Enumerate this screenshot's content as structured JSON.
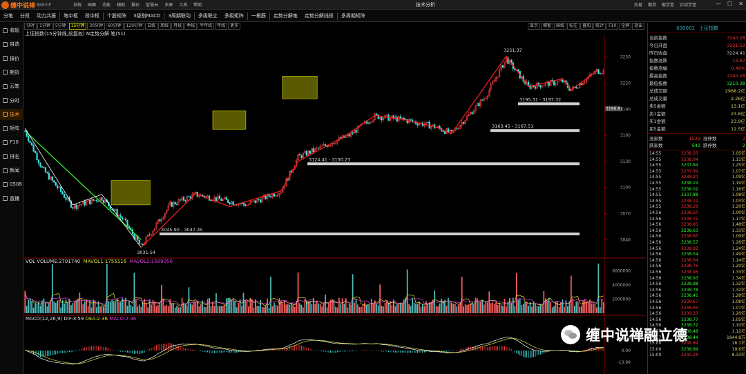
{
  "app": {
    "logo": "缠中说禅",
    "logo_sub": "888VIP",
    "window_title": "技术分析"
  },
  "top_menu": [
    "系统",
    "画面",
    "功能",
    "辅助",
    "报价",
    "智慧云",
    "多屏",
    "工具",
    "帮助"
  ],
  "top_right": [
    "交易",
    "期货",
    "融学堂",
    "实战学堂"
  ],
  "toolbar": [
    "分笔",
    "分段",
    "动力共振",
    "笔中枢",
    "段中枢",
    "个股矩阵",
    "3级别MACD",
    "3周期联动",
    "多级联立",
    "多级矩阵",
    "一根筋",
    "走势分解笔",
    "走势分解线段",
    "多周期矩阵"
  ],
  "sidebar": [
    {
      "label": "收起",
      "icon": "collapse-icon"
    },
    {
      "label": "自选",
      "icon": "star-icon"
    },
    {
      "label": "报价",
      "icon": "quote-icon"
    },
    {
      "label": "期货",
      "icon": "futures-icon"
    },
    {
      "label": "云笔",
      "icon": "cloud-icon"
    },
    {
      "label": "分时",
      "icon": "clock-icon"
    },
    {
      "label": "技术",
      "icon": "candle-icon"
    },
    {
      "label": "矩阵",
      "icon": "grid-icon"
    },
    {
      "label": "F10",
      "icon": "doc-icon"
    },
    {
      "label": "排名",
      "icon": "rank-icon"
    },
    {
      "label": "新闻",
      "icon": "news-icon"
    },
    {
      "label": "0508",
      "icon": "bars-icon"
    },
    {
      "label": "直播",
      "icon": "tv-icon"
    }
  ],
  "sidebar_active": 6,
  "periods": [
    "分时",
    "1分钟",
    "5分钟",
    "15分钟",
    "30分钟",
    "60分钟",
    "120分钟",
    "日线",
    "周线",
    "月线",
    "季线",
    "半年线",
    "年线",
    "更多"
  ],
  "period_selected": 3,
  "right_tools": [
    "显示",
    "模板",
    "画线",
    "标注",
    "叠加",
    "统计",
    "F10",
    "全屏",
    "退出"
  ],
  "chart_title": "上证指数(15分钟线,前复权) N走势分解 笔(51)",
  "vol_label": {
    "vol": "VOL VOLUME:2701740",
    "m1": "MAVOL1:1755116",
    "m2": "MAVOL2:1589050"
  },
  "macd_label": {
    "name": "MACD(12,26,9)",
    "dif": "DIF:3.59",
    "dea": "DEA:2.36",
    "macd": "MACD:2.46"
  },
  "chart_data": {
    "type": "candlestick",
    "title": "上证指数(15分钟线,前复权)",
    "price_axis": {
      "ticks": [
        3040,
        3070,
        3100,
        3130,
        3160,
        3190,
        3220,
        3250
      ],
      "range": [
        3022,
        3268
      ],
      "current_marker": "3190.82"
    },
    "vol_axis": {
      "ticks": [
        "6000000",
        "4000000",
        "2000000"
      ]
    },
    "macd_axis": {
      "ticks": [
        "15.00",
        "0.00",
        "-13.99"
      ]
    },
    "zones": [
      {
        "label": "3045.90 - 3047.35",
        "price": 3046.6
      },
      {
        "label": "3124.41 - 3130.23",
        "price": 3127.3
      },
      {
        "label": "3163.45 - 3167.51",
        "price": 3165.5
      },
      {
        "label": "3195.31 - 3197.32",
        "price": 3196.3
      }
    ],
    "annotations": [
      {
        "text": "3251.37",
        "price": 3251.37
      },
      {
        "text": "3031.54",
        "price": 3031.54
      }
    ],
    "key_points": [
      [
        0,
        3165
      ],
      [
        10,
        3122
      ],
      [
        28,
        3078
      ],
      [
        45,
        3088
      ],
      [
        58,
        3062
      ],
      [
        68,
        3032
      ],
      [
        85,
        3080
      ],
      [
        100,
        3092
      ],
      [
        130,
        3080
      ],
      [
        150,
        3096
      ],
      [
        160,
        3135
      ],
      [
        190,
        3160
      ],
      [
        205,
        3182
      ],
      [
        222,
        3178
      ],
      [
        240,
        3170
      ],
      [
        250,
        3162
      ],
      [
        270,
        3205
      ],
      [
        282,
        3248
      ],
      [
        295,
        3216
      ],
      [
        315,
        3222
      ],
      [
        320,
        3212
      ],
      [
        335,
        3234
      ]
    ]
  },
  "right_panel": {
    "code": "000001",
    "name": "上证指数",
    "rows": [
      {
        "k": "当前指数",
        "v": "3240.28",
        "c": "#ff3030"
      },
      {
        "k": "今日开盘",
        "v": "3221.52",
        "c": "#ff3030"
      },
      {
        "k": "昨日收盘",
        "v": "3224.41",
        "c": "#cccccc"
      },
      {
        "k": "指数涨跌",
        "v": "15.87",
        "c": "#ff3030"
      },
      {
        "k": "指数涨幅",
        "v": "0.49%",
        "c": "#ff3030"
      },
      {
        "k": "最高指数",
        "v": "3240.28",
        "c": "#ff3030"
      },
      {
        "k": "最低指数",
        "v": "3210.38",
        "c": "#30ff30"
      },
      {
        "k": "总成交额",
        "v": "2968.2亿",
        "c": "#e0d070"
      },
      {
        "k": "总成交量",
        "v": "2.26亿",
        "c": "#e0d070"
      },
      {
        "k": "卖5金额",
        "v": "13.1亿",
        "c": "#e0d070"
      },
      {
        "k": "卖1金额",
        "v": "23.8亿",
        "c": "#e0d070"
      },
      {
        "k": "买1金额",
        "v": "23.9亿",
        "c": "#e0d070"
      },
      {
        "k": "买5金额",
        "v": "12.5亿",
        "c": "#e0d070"
      }
    ],
    "adv": {
      "k1": "涨家数",
      "v1": "1529",
      "k2": "涨停数",
      "v2": "2"
    },
    "dec": {
      "k1": "跌家数",
      "v1": "542",
      "k2": "跌停数",
      "v2": "2"
    },
    "ticks": [
      [
        "14:55",
        "3238.25",
        "1.05亿",
        "r"
      ],
      [
        "14:55",
        "3238.04",
        "1.11亿",
        "r"
      ],
      [
        "14:55",
        "3237.84",
        "1.25亿",
        "g"
      ],
      [
        "14:55",
        "3237.99",
        "1.07亿",
        "r"
      ],
      [
        "14:55",
        "3238.20",
        "1.09亿",
        "r"
      ],
      [
        "14:55",
        "3238.19",
        "1.19亿",
        "g"
      ],
      [
        "14:55",
        "3238.02",
        "1.16亿",
        "g"
      ],
      [
        "14:55",
        "3237.88",
        "1.08亿",
        "g"
      ],
      [
        "14:55",
        "3238.12",
        "1.03亿",
        "r"
      ],
      [
        "14:55",
        "3238.29",
        "1.20亿",
        "r"
      ],
      [
        "14:56",
        "3238.50",
        "1.00亿",
        "r"
      ],
      [
        "14:56",
        "3238.71",
        "1.17亿",
        "r"
      ],
      [
        "14:56",
        "3238.83",
        "1.48亿",
        "r"
      ],
      [
        "14:56",
        "3238.63",
        "1.33亿",
        "g"
      ],
      [
        "14:56",
        "3238.65",
        "1.09亿",
        "r"
      ],
      [
        "14:56",
        "3238.57",
        "1.26亿",
        "g"
      ],
      [
        "14:56",
        "3238.82",
        "1.24亿",
        "r"
      ],
      [
        "14:56",
        "3238.54",
        "1.49亿",
        "g"
      ],
      [
        "14:56",
        "3238.64",
        "1.14亿",
        "r"
      ],
      [
        "14:56",
        "3238.76",
        "1.20亿",
        "r"
      ],
      [
        "14:56",
        "3238.96",
        "1.33亿",
        "r"
      ],
      [
        "14:56",
        "3238.93",
        "1.34亿",
        "g"
      ],
      [
        "14:56",
        "3238.88",
        "1.32亿",
        "g"
      ],
      [
        "14:56",
        "3238.78",
        "1.32亿",
        "g"
      ],
      [
        "14:56",
        "3238.41",
        "1.28亿",
        "g"
      ],
      [
        "14:56",
        "3238.67",
        "1.08亿",
        "r"
      ],
      [
        "14:56",
        "3238.69",
        "1.07亿",
        "r"
      ],
      [
        "14:56",
        "3239.23",
        "1.20亿",
        "r"
      ],
      [
        "14:56",
        "3238.77",
        "1.05亿",
        "g"
      ],
      [
        "14:56",
        "3238.72",
        "1.10亿",
        "g"
      ],
      [
        "14:57",
        "3238.48",
        "1.12亿",
        "g"
      ],
      [
        "14:57",
        "3238.44",
        "1844.8万",
        "g"
      ],
      [
        "15:00",
        "3238.89",
        "16.1亿",
        "r"
      ],
      [
        "15:00",
        "3238.89",
        "19.6亿",
        "g"
      ],
      [
        "15:00",
        "3240.28",
        "8.33亿",
        "r"
      ]
    ]
  },
  "watermark": "缠中说禅融立德"
}
